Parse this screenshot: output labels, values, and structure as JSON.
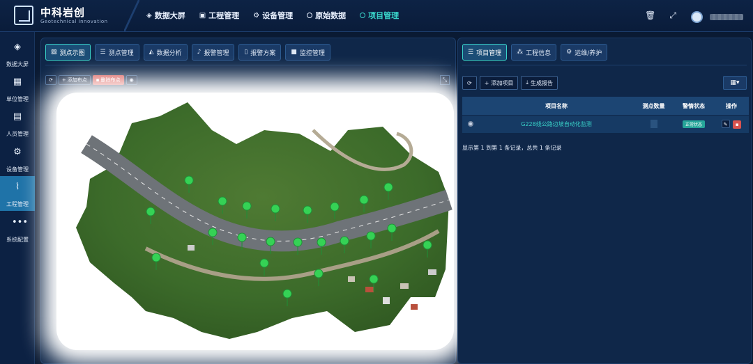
{
  "brand": {
    "title": "中科岩创",
    "subtitle": "Geotechnical Innovation"
  },
  "topnav": [
    {
      "icon": "cube-icon",
      "label": "数据大屏",
      "active": false
    },
    {
      "icon": "monitor-icon",
      "label": "工程管理",
      "active": false
    },
    {
      "icon": "gear-icon",
      "label": "设备管理",
      "active": false
    },
    {
      "icon": "circle-icon",
      "label": "原始数据",
      "active": false
    },
    {
      "icon": "circle-icon",
      "label": "项目管理",
      "active": true
    }
  ],
  "sidebar": [
    {
      "icon": "cube-icon",
      "label": "数据大屏"
    },
    {
      "icon": "calendar-check-icon",
      "label": "单位管理"
    },
    {
      "icon": "user-doc-icon",
      "label": "人员管理"
    },
    {
      "icon": "gear-icon",
      "label": "设备管理"
    },
    {
      "icon": "chart-icon",
      "label": "工程管理",
      "active": true
    },
    {
      "icon": "dots-icon",
      "label": "系统配置"
    }
  ],
  "left_tabs": [
    {
      "label": "测点示图",
      "active": true
    },
    {
      "label": "测点管理"
    },
    {
      "label": "数据分析"
    },
    {
      "label": "报警管理"
    },
    {
      "label": "报警方案"
    },
    {
      "label": "监控管理"
    }
  ],
  "map_tools": {
    "add_label": "添加布点",
    "delete_label": "删除布点"
  },
  "right_tabs": [
    {
      "label": "项目管理",
      "active": true
    },
    {
      "label": "工程信息"
    },
    {
      "label": "运维/养护"
    }
  ],
  "right_tools": {
    "add_label": "添加项目",
    "report_label": "生成报告"
  },
  "table": {
    "headers": [
      "项目名称",
      "测点数量",
      "警情状态",
      "操作"
    ],
    "rows": [
      {
        "name": "G228线公路边坡自动化监测",
        "status": "正常状态"
      }
    ]
  },
  "summary": "显示第 1 到第 1 条记录，总共 1 条记录",
  "colors": {
    "accent": "#39d3c9",
    "active_sidebar": "#1f73a8",
    "danger": "#d9534f"
  }
}
